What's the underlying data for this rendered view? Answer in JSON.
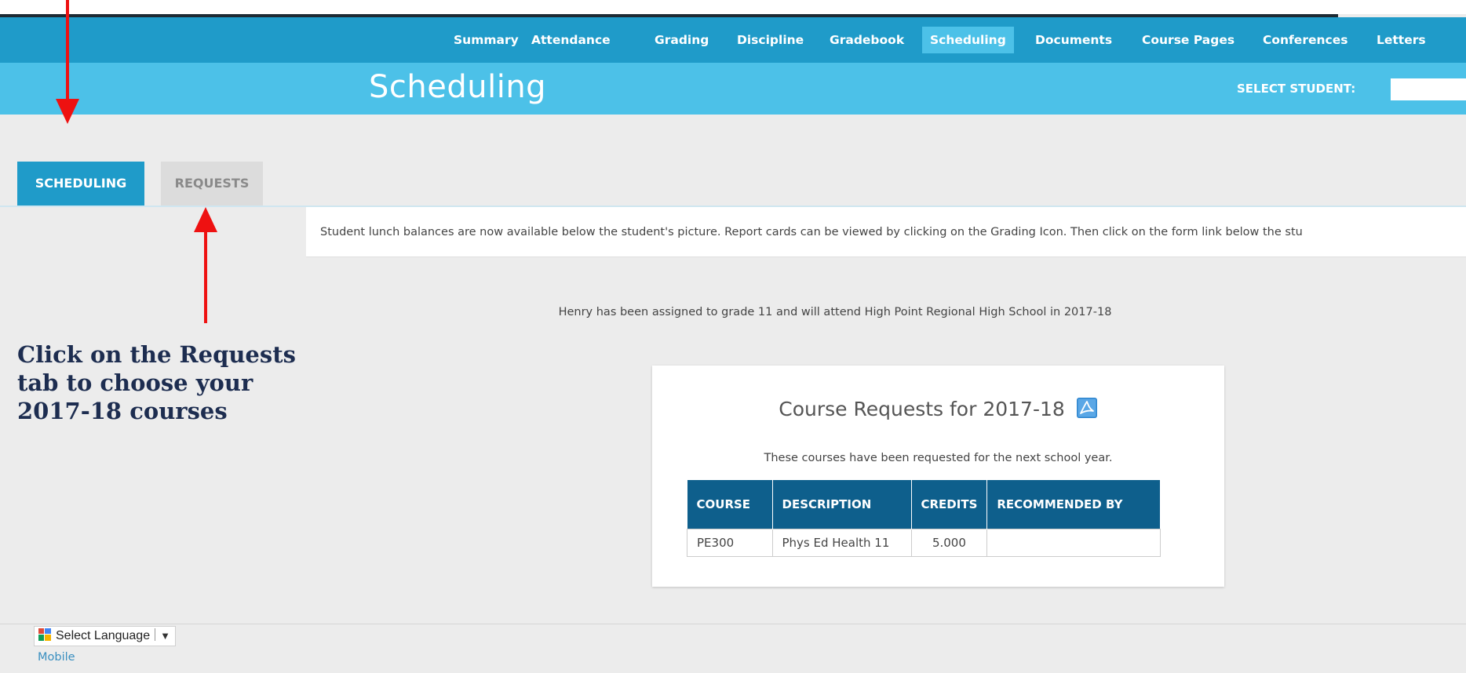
{
  "nav": {
    "items": [
      {
        "label": "Summary",
        "active": false
      },
      {
        "label": "Attendance",
        "active": false
      },
      {
        "label": "Grading",
        "active": false
      },
      {
        "label": "Discipline",
        "active": false
      },
      {
        "label": "Gradebook",
        "active": false
      },
      {
        "label": "Scheduling",
        "active": true
      },
      {
        "label": "Documents",
        "active": false
      },
      {
        "label": "Course Pages",
        "active": false
      },
      {
        "label": "Conferences",
        "active": false
      },
      {
        "label": "Letters",
        "active": false
      }
    ]
  },
  "header": {
    "title": "Scheduling",
    "select_student_label": "SELECT STUDENT:",
    "select_student_value": ""
  },
  "tabs": {
    "scheduling_label": "SCHEDULING",
    "requests_label": "REQUESTS",
    "active": "SCHEDULING"
  },
  "announcement": "Student lunch balances are now available below the student's picture. Report cards can be viewed by clicking on the Grading Icon. Then click on the form link below the stu",
  "assigned_text": "Henry has been assigned to grade 11 and will attend High Point Regional High School in 2017-18",
  "course_requests": {
    "title": "Course Requests for 2017-18",
    "pdf_icon": "pdf-icon",
    "subtitle": "These courses have been requested for the next school year.",
    "columns": [
      "COURSE",
      "DESCRIPTION",
      "CREDITS",
      "RECOMMENDED BY"
    ],
    "rows": [
      {
        "course": "PE300",
        "description": "Phys Ed Health 11",
        "credits": "5.000",
        "recommended_by": ""
      }
    ]
  },
  "footer": {
    "select_language": "Select Language",
    "dropdown_arrow": "▼",
    "mobile_link": "Mobile"
  },
  "annotation": {
    "lines": [
      "Click on the Requests",
      "tab to choose your",
      "2017-18 courses"
    ],
    "arrow_color": "#ee1111"
  },
  "colors": {
    "nav_bar": "#1f9bc9",
    "header_band": "#4cc1e8",
    "table_header": "#0e5f8c",
    "callout_text": "#1d2d50"
  }
}
